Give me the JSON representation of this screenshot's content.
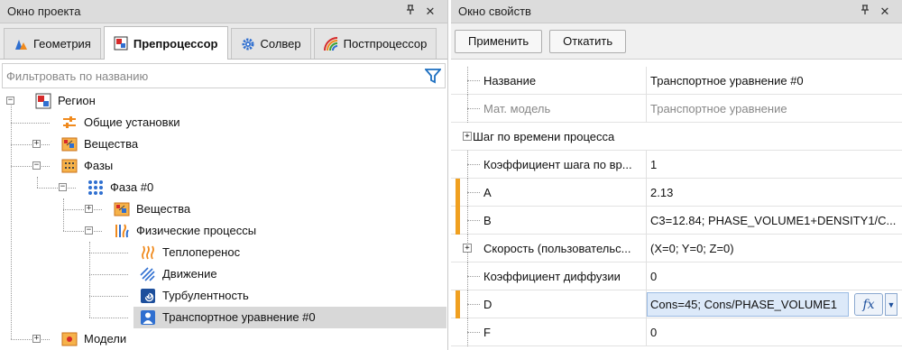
{
  "left_panel": {
    "title": "Окно проекта",
    "tabs": [
      {
        "label": "Геометрия",
        "active": false
      },
      {
        "label": "Препроцессор",
        "active": true
      },
      {
        "label": "Солвер",
        "active": false
      },
      {
        "label": "Постпроцессор",
        "active": false
      }
    ],
    "filter": {
      "placeholder": "Фильтровать по названию",
      "value": ""
    },
    "tree": [
      {
        "label": "Регион",
        "level": 0,
        "expander": "−",
        "icon": "region-icon"
      },
      {
        "label": "Общие установки",
        "level": 1,
        "expander": "",
        "icon": "sliders-icon"
      },
      {
        "label": "Вещества",
        "level": 1,
        "expander": "+",
        "icon": "substances-icon"
      },
      {
        "label": "Фазы",
        "level": 1,
        "expander": "−",
        "icon": "phases-icon"
      },
      {
        "label": "Фаза #0",
        "level": 2,
        "expander": "−",
        "icon": "phase-dots-icon"
      },
      {
        "label": "Вещества",
        "level": 3,
        "expander": "+",
        "icon": "substances-icon"
      },
      {
        "label": "Физические процессы",
        "level": 3,
        "expander": "−",
        "icon": "physics-processes-icon"
      },
      {
        "label": "Теплоперенос",
        "level": 4,
        "expander": "",
        "icon": "heat-transfer-icon"
      },
      {
        "label": "Движение",
        "level": 4,
        "expander": "",
        "icon": "motion-icon"
      },
      {
        "label": "Турбулентность",
        "level": 4,
        "expander": "",
        "icon": "turbulence-icon"
      },
      {
        "label": "Транспортное уравнение #0",
        "level": 4,
        "expander": "",
        "icon": "transport-equation-icon",
        "selected": true
      },
      {
        "label": "Модели",
        "level": 1,
        "expander": "+",
        "icon": "models-icon"
      }
    ]
  },
  "right_panel": {
    "title": "Окно свойств",
    "apply_label": "Применить",
    "revert_label": "Откатить",
    "rows": [
      {
        "name": "Название",
        "value": "Транспортное уравнение #0"
      },
      {
        "name": "Мат. модель",
        "value": "Транспортное уравнение",
        "grey": true
      },
      {
        "name": "Шаг по времени процесса",
        "value": "",
        "group": true,
        "expander": "+"
      },
      {
        "name": "Коэффициент шага по вр...",
        "value": "1"
      },
      {
        "name": "A",
        "value": "2.13",
        "marker": true
      },
      {
        "name": "B",
        "value": "C3=12.84; PHASE_VOLUME1+DENSITY1/C...",
        "marker": true
      },
      {
        "name": "Скорость (пользовательс...",
        "value": "(X=0; Y=0; Z=0)",
        "expander": "+"
      },
      {
        "name": "Коэффициент диффузии",
        "value": "0"
      },
      {
        "name": "D",
        "value": "Cons=45; Cons/PHASE_VOLUME1",
        "marker": true,
        "editing": true
      },
      {
        "name": "F",
        "value": "0"
      }
    ],
    "fx_label": "fx"
  },
  "colors": {
    "accent_marker": "#f0a020",
    "title_bar": "#dcdcdc",
    "selection": "#d8d8d8",
    "edit_bg": "#dce9f9"
  }
}
